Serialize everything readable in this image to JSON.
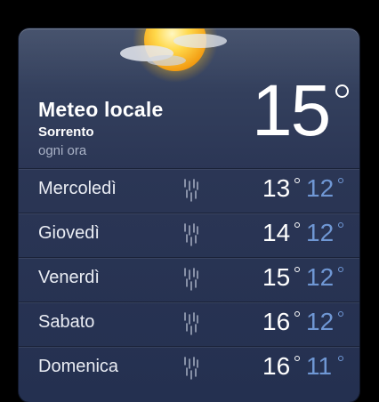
{
  "header": {
    "title": "Meteo locale",
    "location": "Sorrento",
    "subtitle": "ogni ora",
    "current_temp": "15",
    "condition_icon": "sun-with-clouds-icon"
  },
  "forecast": [
    {
      "day": "Mercoledì",
      "high": "13",
      "low": "12",
      "icon": "rain-icon"
    },
    {
      "day": "Giovedì",
      "high": "14",
      "low": "12",
      "icon": "rain-icon"
    },
    {
      "day": "Venerdì",
      "high": "15",
      "low": "12",
      "icon": "rain-icon"
    },
    {
      "day": "Sabato",
      "high": "16",
      "low": "12",
      "icon": "rain-icon"
    },
    {
      "day": "Domenica",
      "high": "16",
      "low": "11",
      "icon": "rain-icon"
    }
  ],
  "colors": {
    "high_temp": "#ffffff",
    "low_temp": "#6f97d4",
    "panel": "#2b3655"
  }
}
